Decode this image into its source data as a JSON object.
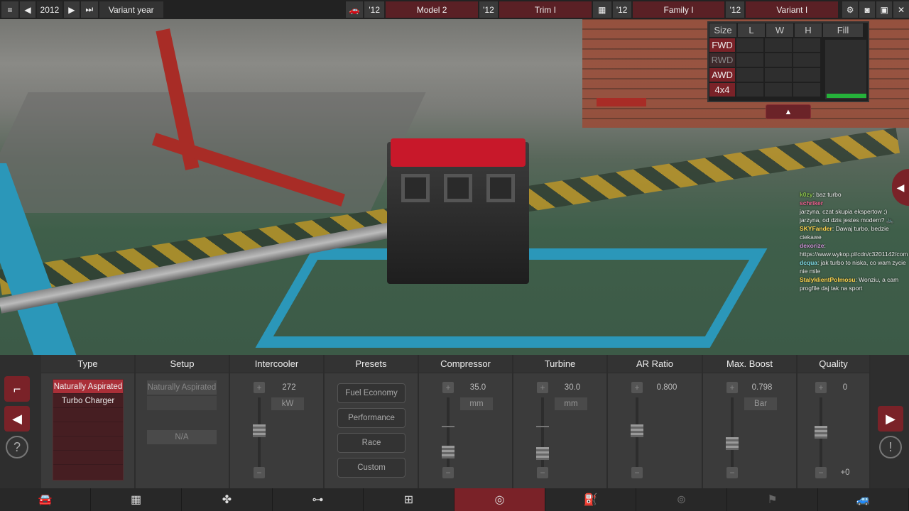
{
  "topbar": {
    "year": "2012",
    "year_label": "Variant year",
    "model_year": "'12",
    "model": "Model 2",
    "trim_year": "'12",
    "trim": "Trim I",
    "family_year": "'12",
    "family": "Family I",
    "variant_year": "'12",
    "variant": "Variant I"
  },
  "size_panel": {
    "headers": [
      "Size",
      "L",
      "W",
      "H",
      "Fill"
    ],
    "drives": [
      "FWD",
      "RWD",
      "AWD",
      "4x4"
    ]
  },
  "chat": [
    {
      "user": "k0zy",
      "text": "baz turbo"
    },
    {
      "user": "schriker",
      "text": ""
    },
    {
      "user": "",
      "text": "jarzyna, czat skupia ekspertow ;)"
    },
    {
      "user": "",
      "text": "jarzyna, od dzis jestes modern? 🚲"
    },
    {
      "user": "SKYFander",
      "text": "Dawaj turbo, bedzie ciekawe"
    },
    {
      "user": "dexorize",
      "text": "https://www.wykop.pl/cdn/c3201142/com"
    },
    {
      "user": "dcqua",
      "text": "jak turbo to niska, co wam zycie nie mile"
    },
    {
      "user": "StalyklientPolmosu",
      "text": "Wonziu, a cam progfile daj tak na sport"
    }
  ],
  "panel": {
    "headers": {
      "type": "Type",
      "setup": "Setup",
      "intercooler": "Intercooler",
      "presets": "Presets",
      "compressor": "Compressor",
      "turbine": "Turbine",
      "ar": "AR Ratio",
      "boost": "Max. Boost",
      "quality": "Quality"
    },
    "type_options": [
      "Naturally Aspirated",
      "Turbo Charger"
    ],
    "setup_value": "Naturally Aspirated",
    "setup_na": "N/A",
    "intercooler": {
      "value": "272",
      "unit": "kW"
    },
    "presets": [
      "Fuel Economy",
      "Performance",
      "Race",
      "Custom"
    ],
    "compressor": {
      "value": "35.0",
      "unit": "mm"
    },
    "turbine": {
      "value": "30.0",
      "unit": "mm"
    },
    "ar": {
      "value": "0.800"
    },
    "boost": {
      "value": "0.798",
      "unit": "Bar"
    },
    "quality": {
      "value": "0",
      "bottom": "+0"
    }
  },
  "colors": {
    "accent": "#7a2228",
    "fill_green": "#25b13a",
    "frame_blue": "#2b97b9"
  }
}
